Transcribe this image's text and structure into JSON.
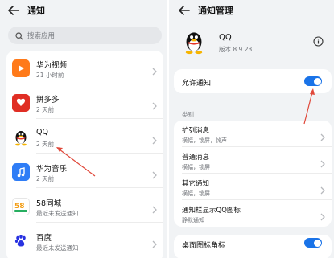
{
  "left": {
    "title": "通知",
    "search_placeholder": "搜索应用",
    "apps": [
      {
        "name": "华为视频",
        "sub": "21 小时前",
        "color": "#ff7a1a",
        "icon": "huawei-video-icon"
      },
      {
        "name": "拼多多",
        "sub": "2 天前",
        "color": "#e02e24",
        "icon": "pinduoduo-icon"
      },
      {
        "name": "QQ",
        "sub": "2 天前",
        "color": "#ffffff",
        "icon": "qq-penguin-icon"
      },
      {
        "name": "华为音乐",
        "sub": "2 天前",
        "color": "#2f7df6",
        "icon": "huawei-music-icon"
      },
      {
        "name": "58同城",
        "sub": "最近未发送通知",
        "color": "#ffffff",
        "icon": "58-city-icon"
      },
      {
        "name": "百度",
        "sub": "最近未发送通知",
        "color": "#ffffff",
        "icon": "baidu-paw-icon"
      }
    ]
  },
  "right": {
    "title": "通知管理",
    "app_name": "QQ",
    "version": "版本 8.9.23",
    "allow_label": "允许通知",
    "allow_on": true,
    "category_label": "类别",
    "options": [
      {
        "name": "扩列消息",
        "sub": "横幅，锁屏，铃声"
      },
      {
        "name": "普通消息",
        "sub": "横幅，锁屏"
      },
      {
        "name": "其它通知",
        "sub": "横幅，锁屏"
      },
      {
        "name": "通知栏显示QQ图标",
        "sub": "静默通知"
      }
    ],
    "badge_label": "桌面图标角标",
    "badge_on": true
  },
  "colors": {
    "accent": "#1a73e8",
    "annotation_arrow": "#e0483a",
    "panel_bg": "#f1f3f5"
  }
}
